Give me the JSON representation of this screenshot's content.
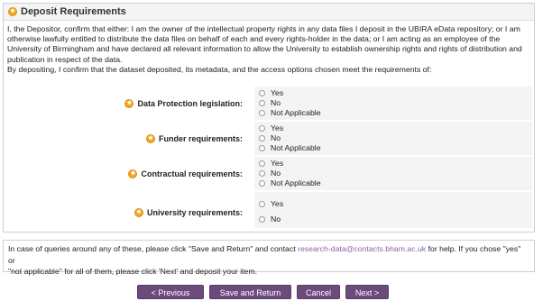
{
  "panel": {
    "title": "Deposit Requirements",
    "intro_line1": "I, the Depositor, confirm that either: I am the owner of the intellectual property rights in any data files I deposit in the UBIRA eData repository; or I am",
    "intro_line2": "otherwise lawfully entitled to distribute the data files on behalf of each and every rights-holder in the data; or I am acting as an employee of the",
    "intro_line3": "University of Birmingham and have declared all relevant information to allow the University to establish ownership rights and rights of distribution and",
    "intro_line4": "publication in respect of the data.",
    "intro_line5": "By depositing, I confirm that the dataset deposited, its metadata, and the access options chosen meet the requirements of:"
  },
  "questions": [
    {
      "label": "Data Protection legislation:",
      "options": [
        "Yes",
        "No",
        "Not Applicable"
      ]
    },
    {
      "label": "Funder requirements:",
      "options": [
        "Yes",
        "No",
        "Not Applicable"
      ]
    },
    {
      "label": "Contractual requirements:",
      "options": [
        "Yes",
        "No",
        "Not Applicable"
      ]
    },
    {
      "label": "University requirements:",
      "options": [
        "Yes",
        "No"
      ]
    }
  ],
  "info": {
    "text_before": "In case of queries around any of these, please click \"Save and Return\" and contact ",
    "email": "research-data@contacts.bham.ac.uk",
    "text_after_line1": " for help. If you chose \"yes\" or",
    "line2": "\"not applicable\" for all of them, please click 'Next' and deposit your item."
  },
  "buttons": {
    "previous": "< Previous",
    "save_return": "Save and Return",
    "cancel": "Cancel",
    "next": "Next >"
  },
  "colors": {
    "accent": "#6b4a7c",
    "star": "#f0a818",
    "link": "#8a63a6"
  }
}
